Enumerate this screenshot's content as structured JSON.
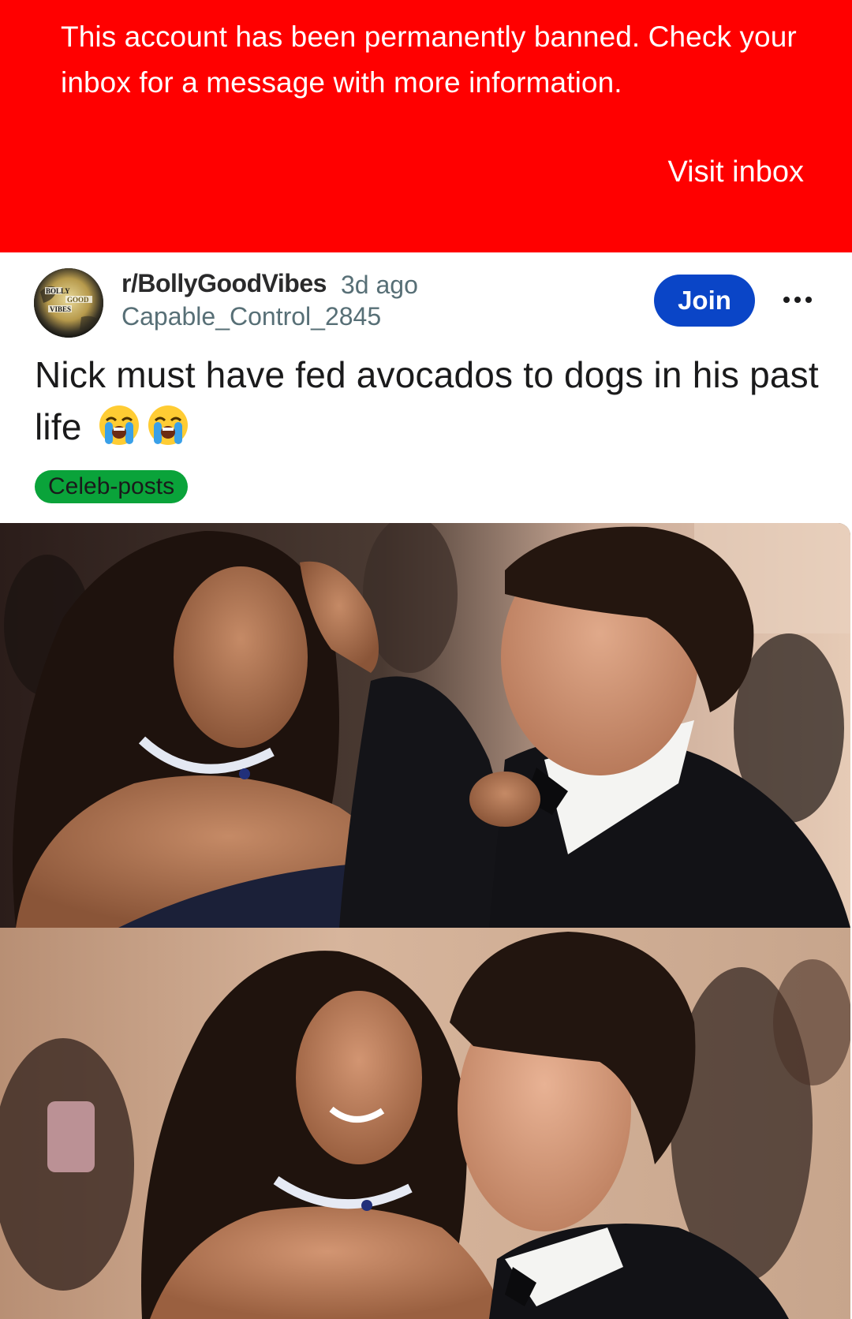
{
  "banner": {
    "message": "This account has been permanently banned. Check your inbox for a message with more information.",
    "action_label": "Visit inbox",
    "background_color": "#ff0000"
  },
  "post": {
    "subreddit": "r/BollyGoodVibes",
    "time_ago": "3d ago",
    "author": "Capable_Control_2845",
    "join_label": "Join",
    "title": "Nick must have fed avocados to dogs in his past life",
    "title_emojis": [
      "loudly-crying-face-emoji",
      "loudly-crying-face-emoji"
    ],
    "flair": "Celeb-posts",
    "flair_color": "#0aa33a",
    "join_color": "#0a45c7",
    "avatar_icon": "subreddit-avatar-icon",
    "more_icon": "more-options-icon",
    "avatar_text": [
      "BOLLY",
      "GOOD",
      "VIBES"
    ]
  }
}
